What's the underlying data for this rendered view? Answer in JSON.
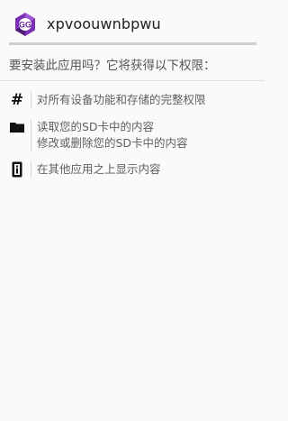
{
  "header": {
    "app_name": "xpvoouwnbpwu",
    "app_icon": "gg-app-icon"
  },
  "prompt": "要安装此应用吗？它将获得以下权限：",
  "permissions": [
    {
      "icon": "hash-icon",
      "lines": [
        "对所有设备功能和存储的完整权限"
      ]
    },
    {
      "icon": "folder-icon",
      "lines": [
        "读取您的SD卡中的内容",
        "修改或删除您的SD卡中的内容"
      ]
    },
    {
      "icon": "phone-info-icon",
      "lines": [
        "在其他应用之上显示内容"
      ]
    }
  ],
  "colors": {
    "icon_purple": "#7b2fb5",
    "icon_purple_dark": "#4e1a7a",
    "text_primary": "#212121",
    "text_secondary": "#5f5f5f",
    "divider": "#cfcfcf"
  }
}
